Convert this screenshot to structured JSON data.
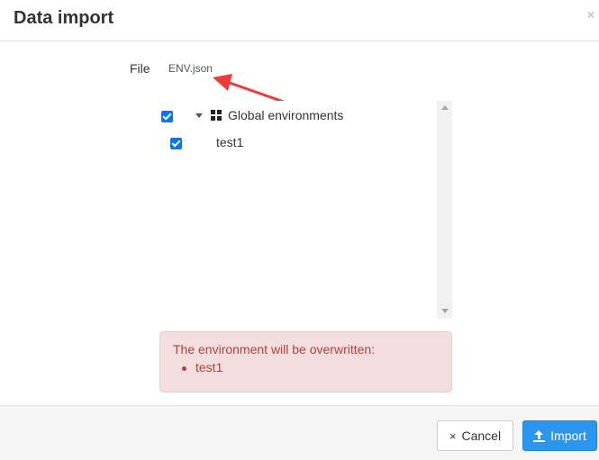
{
  "dialog": {
    "title": "Data import",
    "close_symbol": "×"
  },
  "file": {
    "label": "File",
    "name": "ENV.json"
  },
  "tree": {
    "root": {
      "label": "Global environments",
      "checked": true,
      "icon": "grid-icon"
    },
    "items": [
      {
        "label": "test1",
        "checked": true
      }
    ]
  },
  "alert": {
    "message": "The environment will be overwritten:",
    "items": [
      "test1"
    ]
  },
  "footer": {
    "cancel_label": "Cancel",
    "cancel_icon": "×",
    "import_label": "Import"
  },
  "colors": {
    "accent": "#2a96ef",
    "checkbox": "#0075ff",
    "alert_text": "#a94442",
    "alert_bg": "#f2dede",
    "annotation_arrow": "#f03a3a"
  }
}
